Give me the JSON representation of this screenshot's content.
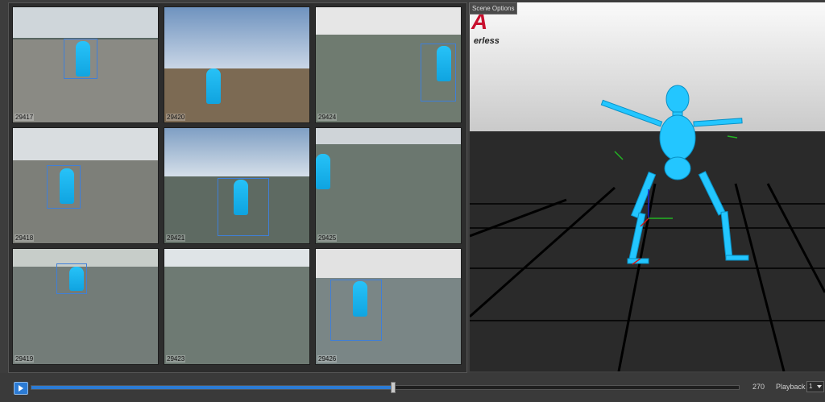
{
  "scene_options_label": "Scene Options",
  "viewport": {
    "brand_text": "A",
    "brand_sub": "erless"
  },
  "cameras": [
    {
      "frame": "29417"
    },
    {
      "frame": "29420"
    },
    {
      "frame": "29424"
    },
    {
      "frame": "29418"
    },
    {
      "frame": "29421"
    },
    {
      "frame": "29425"
    },
    {
      "frame": "29419"
    },
    {
      "frame": "29423"
    },
    {
      "frame": "29426"
    }
  ],
  "playback": {
    "frame_value": "270",
    "label": "Playback",
    "speed": "1",
    "progress_fraction": 0.51
  },
  "colors": {
    "accent": "#2c7bd4",
    "skeleton": "#23c6ff",
    "brand": "#c8102e"
  },
  "icons": {
    "play": "play-icon",
    "dropdown": "chevron-down-icon"
  }
}
